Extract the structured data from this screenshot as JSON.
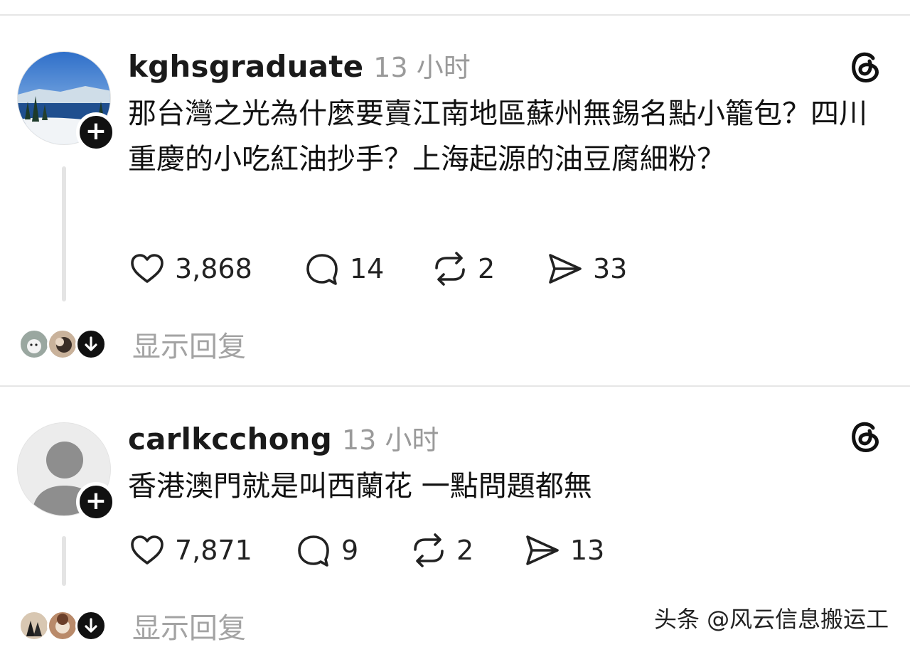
{
  "posts": [
    {
      "username": "kghsgraduate",
      "time": "13 小时",
      "text": "那台灣之光為什麼要賣江南地區蘇州無錫名點小籠包？四川重慶的小吃紅油抄手？上海起源的油豆腐細粉？",
      "likes": "3,868",
      "comments": "14",
      "reposts": "2",
      "shares": "33",
      "show_replies": "显示回复",
      "avatar": "landscape-lake-photo"
    },
    {
      "username": "carlkcchong",
      "time": "13 小时",
      "text": "香港澳門就是叫西蘭花 一點問題都無",
      "likes": "7,871",
      "comments": "9",
      "reposts": "2",
      "shares": "13",
      "show_replies": "显示回复",
      "avatar": "default-person-placeholder"
    }
  ],
  "watermark": "头条 @风云信息搬运工",
  "colors": {
    "text": "#111111",
    "muted": "#9a9a9a",
    "divider": "#e6e6e6",
    "badge": "#111111"
  }
}
